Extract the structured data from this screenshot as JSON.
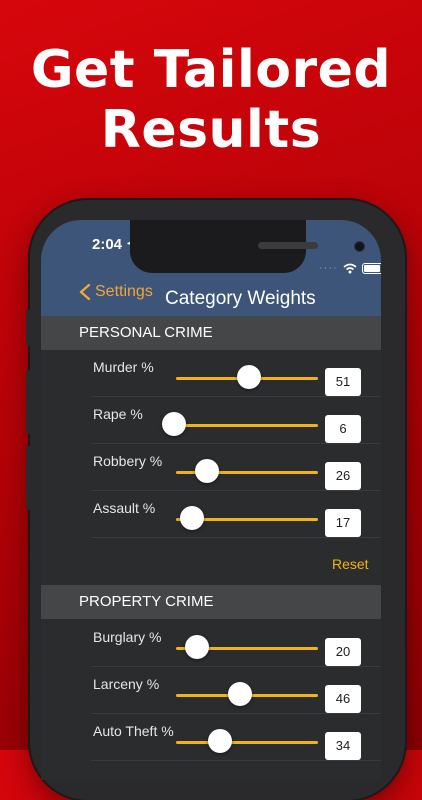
{
  "headline": {
    "line1": "Get Tailored",
    "line2": "Results"
  },
  "status_bar": {
    "time": "2:04",
    "dots": "····"
  },
  "nav": {
    "back_label": "Settings",
    "title": "Category Weights"
  },
  "sections": [
    {
      "title": "PERSONAL CRIME",
      "rows": [
        {
          "label": "Murder %",
          "value": "51",
          "fraction": 0.51
        },
        {
          "label": "Rape %",
          "value": "6",
          "fraction": 0.06
        },
        {
          "label": "Robbery %",
          "value": "26",
          "fraction": 0.26
        },
        {
          "label": "Assault %",
          "value": "17",
          "fraction": 0.17
        }
      ],
      "reset_label": "Reset"
    },
    {
      "title": "PROPERTY CRIME",
      "rows": [
        {
          "label": "Burglary %",
          "value": "20",
          "fraction": 0.2
        },
        {
          "label": "Larceny %",
          "value": "46",
          "fraction": 0.46
        },
        {
          "label": "Auto Theft %",
          "value": "34",
          "fraction": 0.34
        }
      ]
    }
  ],
  "colors": {
    "accent": "#f0b419",
    "back": "#f0a53a",
    "navbar": "#3d5578",
    "background": "#c9040a"
  },
  "icons": {
    "location": "location-arrow-icon",
    "wifi": "wifi-icon",
    "battery": "battery-icon",
    "back": "chevron-left-icon"
  }
}
